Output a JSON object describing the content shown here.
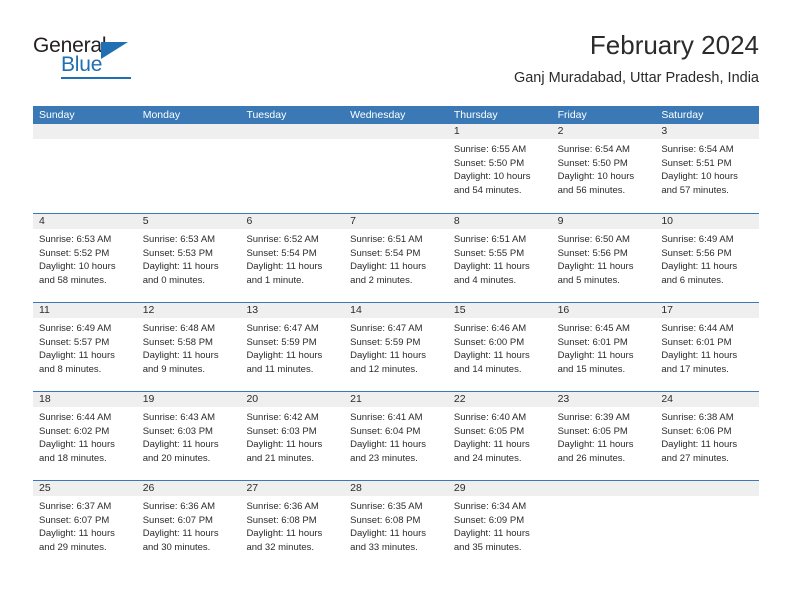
{
  "brand": {
    "name_part1": "General",
    "name_part2": "Blue",
    "triangle_icon": "triangle-icon",
    "accent_color": "#1f6fb2"
  },
  "header": {
    "title": "February 2024",
    "subtitle": "Ganj Muradabad, Uttar Pradesh, India"
  },
  "theme": {
    "header_blue": "#3a79b5",
    "day_strip_gray": "#efefef",
    "text_color": "#2b2b2b"
  },
  "weekdays": [
    "Sunday",
    "Monday",
    "Tuesday",
    "Wednesday",
    "Thursday",
    "Friday",
    "Saturday"
  ],
  "weeks": [
    [
      {
        "date": "",
        "sunrise": "",
        "sunset": "",
        "daylight": ""
      },
      {
        "date": "",
        "sunrise": "",
        "sunset": "",
        "daylight": ""
      },
      {
        "date": "",
        "sunrise": "",
        "sunset": "",
        "daylight": ""
      },
      {
        "date": "",
        "sunrise": "",
        "sunset": "",
        "daylight": ""
      },
      {
        "date": "1",
        "sunrise": "Sunrise: 6:55 AM",
        "sunset": "Sunset: 5:50 PM",
        "daylight": "Daylight: 10 hours and 54 minutes."
      },
      {
        "date": "2",
        "sunrise": "Sunrise: 6:54 AM",
        "sunset": "Sunset: 5:50 PM",
        "daylight": "Daylight: 10 hours and 56 minutes."
      },
      {
        "date": "3",
        "sunrise": "Sunrise: 6:54 AM",
        "sunset": "Sunset: 5:51 PM",
        "daylight": "Daylight: 10 hours and 57 minutes."
      }
    ],
    [
      {
        "date": "4",
        "sunrise": "Sunrise: 6:53 AM",
        "sunset": "Sunset: 5:52 PM",
        "daylight": "Daylight: 10 hours and 58 minutes."
      },
      {
        "date": "5",
        "sunrise": "Sunrise: 6:53 AM",
        "sunset": "Sunset: 5:53 PM",
        "daylight": "Daylight: 11 hours and 0 minutes."
      },
      {
        "date": "6",
        "sunrise": "Sunrise: 6:52 AM",
        "sunset": "Sunset: 5:54 PM",
        "daylight": "Daylight: 11 hours and 1 minute."
      },
      {
        "date": "7",
        "sunrise": "Sunrise: 6:51 AM",
        "sunset": "Sunset: 5:54 PM",
        "daylight": "Daylight: 11 hours and 2 minutes."
      },
      {
        "date": "8",
        "sunrise": "Sunrise: 6:51 AM",
        "sunset": "Sunset: 5:55 PM",
        "daylight": "Daylight: 11 hours and 4 minutes."
      },
      {
        "date": "9",
        "sunrise": "Sunrise: 6:50 AM",
        "sunset": "Sunset: 5:56 PM",
        "daylight": "Daylight: 11 hours and 5 minutes."
      },
      {
        "date": "10",
        "sunrise": "Sunrise: 6:49 AM",
        "sunset": "Sunset: 5:56 PM",
        "daylight": "Daylight: 11 hours and 6 minutes."
      }
    ],
    [
      {
        "date": "11",
        "sunrise": "Sunrise: 6:49 AM",
        "sunset": "Sunset: 5:57 PM",
        "daylight": "Daylight: 11 hours and 8 minutes."
      },
      {
        "date": "12",
        "sunrise": "Sunrise: 6:48 AM",
        "sunset": "Sunset: 5:58 PM",
        "daylight": "Daylight: 11 hours and 9 minutes."
      },
      {
        "date": "13",
        "sunrise": "Sunrise: 6:47 AM",
        "sunset": "Sunset: 5:59 PM",
        "daylight": "Daylight: 11 hours and 11 minutes."
      },
      {
        "date": "14",
        "sunrise": "Sunrise: 6:47 AM",
        "sunset": "Sunset: 5:59 PM",
        "daylight": "Daylight: 11 hours and 12 minutes."
      },
      {
        "date": "15",
        "sunrise": "Sunrise: 6:46 AM",
        "sunset": "Sunset: 6:00 PM",
        "daylight": "Daylight: 11 hours and 14 minutes."
      },
      {
        "date": "16",
        "sunrise": "Sunrise: 6:45 AM",
        "sunset": "Sunset: 6:01 PM",
        "daylight": "Daylight: 11 hours and 15 minutes."
      },
      {
        "date": "17",
        "sunrise": "Sunrise: 6:44 AM",
        "sunset": "Sunset: 6:01 PM",
        "daylight": "Daylight: 11 hours and 17 minutes."
      }
    ],
    [
      {
        "date": "18",
        "sunrise": "Sunrise: 6:44 AM",
        "sunset": "Sunset: 6:02 PM",
        "daylight": "Daylight: 11 hours and 18 minutes."
      },
      {
        "date": "19",
        "sunrise": "Sunrise: 6:43 AM",
        "sunset": "Sunset: 6:03 PM",
        "daylight": "Daylight: 11 hours and 20 minutes."
      },
      {
        "date": "20",
        "sunrise": "Sunrise: 6:42 AM",
        "sunset": "Sunset: 6:03 PM",
        "daylight": "Daylight: 11 hours and 21 minutes."
      },
      {
        "date": "21",
        "sunrise": "Sunrise: 6:41 AM",
        "sunset": "Sunset: 6:04 PM",
        "daylight": "Daylight: 11 hours and 23 minutes."
      },
      {
        "date": "22",
        "sunrise": "Sunrise: 6:40 AM",
        "sunset": "Sunset: 6:05 PM",
        "daylight": "Daylight: 11 hours and 24 minutes."
      },
      {
        "date": "23",
        "sunrise": "Sunrise: 6:39 AM",
        "sunset": "Sunset: 6:05 PM",
        "daylight": "Daylight: 11 hours and 26 minutes."
      },
      {
        "date": "24",
        "sunrise": "Sunrise: 6:38 AM",
        "sunset": "Sunset: 6:06 PM",
        "daylight": "Daylight: 11 hours and 27 minutes."
      }
    ],
    [
      {
        "date": "25",
        "sunrise": "Sunrise: 6:37 AM",
        "sunset": "Sunset: 6:07 PM",
        "daylight": "Daylight: 11 hours and 29 minutes."
      },
      {
        "date": "26",
        "sunrise": "Sunrise: 6:36 AM",
        "sunset": "Sunset: 6:07 PM",
        "daylight": "Daylight: 11 hours and 30 minutes."
      },
      {
        "date": "27",
        "sunrise": "Sunrise: 6:36 AM",
        "sunset": "Sunset: 6:08 PM",
        "daylight": "Daylight: 11 hours and 32 minutes."
      },
      {
        "date": "28",
        "sunrise": "Sunrise: 6:35 AM",
        "sunset": "Sunset: 6:08 PM",
        "daylight": "Daylight: 11 hours and 33 minutes."
      },
      {
        "date": "29",
        "sunrise": "Sunrise: 6:34 AM",
        "sunset": "Sunset: 6:09 PM",
        "daylight": "Daylight: 11 hours and 35 minutes."
      },
      {
        "date": "",
        "sunrise": "",
        "sunset": "",
        "daylight": ""
      },
      {
        "date": "",
        "sunrise": "",
        "sunset": "",
        "daylight": ""
      }
    ]
  ]
}
